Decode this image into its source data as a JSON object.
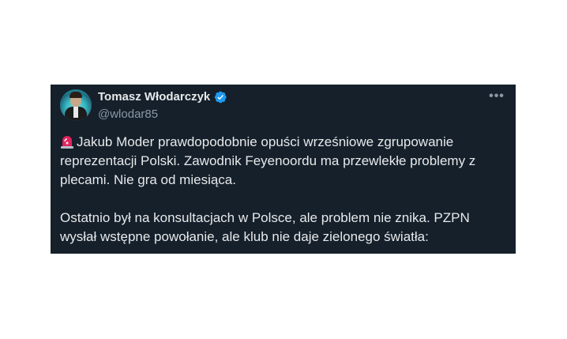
{
  "tweet": {
    "author": {
      "display_name": "Tomasz Włodarczyk",
      "handle": "@wlodar85",
      "verified_icon": "verified-badge-icon",
      "avatar": "avatar"
    },
    "more_label": "•••",
    "body": {
      "paragraph_1_icon": "siren-icon",
      "paragraph_1": "Jakub Moder prawdopodobnie opuści wrześniowe zgrupowanie reprezentacji Polski. Zawodnik Feyenoordu ma przewlekłe problemy z plecami. Nie gra od miesiąca.",
      "paragraph_2": "Ostatnio był na konsultacjach w Polsce, ale problem nie znika. PZPN wysłał wstępne powołanie, ale klub nie daje zielonego światła:"
    },
    "colors": {
      "background": "#15202b",
      "text": "#e7e9ea",
      "muted": "#8b98a5",
      "verified": "#1d9bf0",
      "siren": "#e0245e"
    }
  }
}
